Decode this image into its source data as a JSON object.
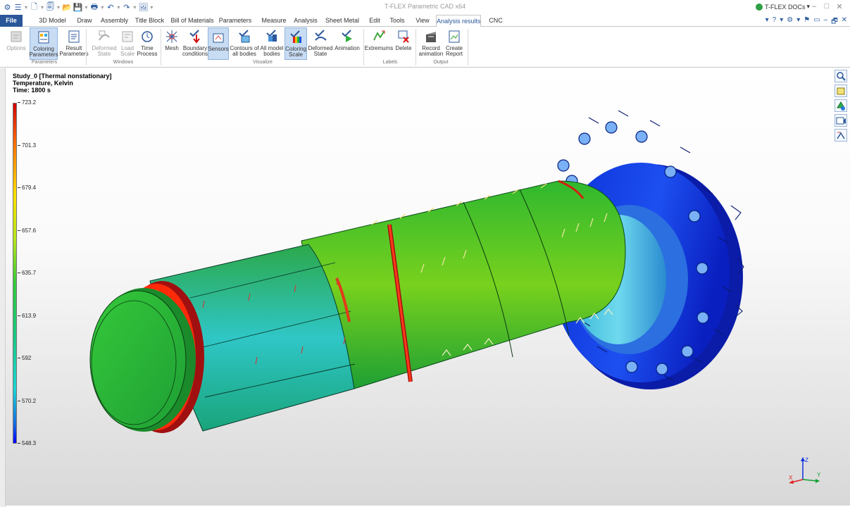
{
  "window": {
    "title": "T-FLEX Parametric CAD x64",
    "docs_label": "T-FLEX DOCs",
    "controls": [
      "–",
      "□",
      "✕"
    ]
  },
  "quick_access": [
    "⚙",
    "☰",
    "▾",
    "🗋",
    "▾",
    "🗐",
    "▾",
    "📂",
    "💾",
    "▾",
    "🖶",
    "▾",
    "↶",
    "▾",
    "↷",
    "▾",
    "🖼",
    "▾"
  ],
  "tabs": [
    {
      "label": "File"
    },
    {
      "label": "3D Model"
    },
    {
      "label": "Draw"
    },
    {
      "label": "Assembly"
    },
    {
      "label": "Title Block"
    },
    {
      "label": "Bill of Materials"
    },
    {
      "label": "Parameters"
    },
    {
      "label": "Measure"
    },
    {
      "label": "Analysis"
    },
    {
      "label": "Sheet Metal"
    },
    {
      "label": "Edit"
    },
    {
      "label": "Tools"
    },
    {
      "label": "View"
    },
    {
      "label": "Analysis results"
    },
    {
      "label": "CNC"
    }
  ],
  "active_tab": "Analysis results",
  "tab_right_icons": [
    "▾",
    "?",
    "▾",
    "⚙",
    "▾",
    "⚑",
    "▭",
    "–",
    "🗗",
    "✕"
  ],
  "ribbon": {
    "buttons": [
      {
        "label": "Options",
        "icon": "options-icon",
        "state": "disabled"
      },
      {
        "label": "Coloring\nParameters",
        "icon": "coloring-parameters-icon",
        "state": "selected"
      },
      {
        "label": "Result\nParameters",
        "icon": "result-parameters-icon",
        "state": "normal"
      },
      {
        "label": "Deformed\nState",
        "icon": "deformed-state-icon",
        "state": "disabled"
      },
      {
        "label": "Load\nScale",
        "icon": "load-scale-icon",
        "state": "disabled"
      },
      {
        "label": "Time\nProcess",
        "icon": "time-process-icon",
        "state": "normal"
      },
      {
        "label": "Mesh",
        "icon": "mesh-icon",
        "state": "normal"
      },
      {
        "label": "Boundary\nconditions",
        "icon": "boundary-conditions-icon",
        "state": "normal"
      },
      {
        "label": "Sensors",
        "icon": "sensors-icon",
        "state": "selected"
      },
      {
        "label": "Contours of\nall bodies",
        "icon": "contours-icon",
        "state": "normal"
      },
      {
        "label": "All model\nbodies",
        "icon": "all-model-bodies-icon",
        "state": "normal"
      },
      {
        "label": "Coloring\nScale",
        "icon": "coloring-scale-icon",
        "state": "selected"
      },
      {
        "label": "Deformed\nState",
        "icon": "deformed-state-2-icon",
        "state": "normal"
      },
      {
        "label": "Animation",
        "icon": "animation-icon",
        "state": "normal"
      },
      {
        "label": "Extremums",
        "icon": "extremums-icon",
        "state": "normal"
      },
      {
        "label": "Delete",
        "icon": "delete-labels-icon",
        "state": "normal"
      },
      {
        "label": "Record\nanimation",
        "icon": "record-animation-icon",
        "state": "normal"
      },
      {
        "label": "Create\nReport",
        "icon": "create-report-icon",
        "state": "normal"
      }
    ],
    "groups": [
      {
        "label": "Parameters"
      },
      {
        "label": "Windows"
      },
      {
        "label": "Visualize"
      },
      {
        "label": "Labels"
      },
      {
        "label": "Output"
      }
    ]
  },
  "study": {
    "name": "Study_0 [Thermal nonstationary]",
    "quantity": "Temperature, Kelvin",
    "time": "Time: 1800 s"
  },
  "color_scale": {
    "ticks": [
      "723.2",
      "701.3",
      "679.4",
      "657.6",
      "635.7",
      "613.9",
      "592",
      "570.2",
      "548.3"
    ],
    "colors": [
      "#d40000",
      "#ff7a00",
      "#ffe100",
      "#b5e61a",
      "#35c83a",
      "#17c87f",
      "#1ad4d4",
      "#1565e0",
      "#0000ff"
    ]
  },
  "view_tools": [
    "zoom-icon",
    "view-box-icon",
    "orientation-icon",
    "view-camera-icon",
    "view-section-icon"
  ],
  "axes": {
    "x": "X",
    "y": "Y",
    "z": "Z"
  }
}
